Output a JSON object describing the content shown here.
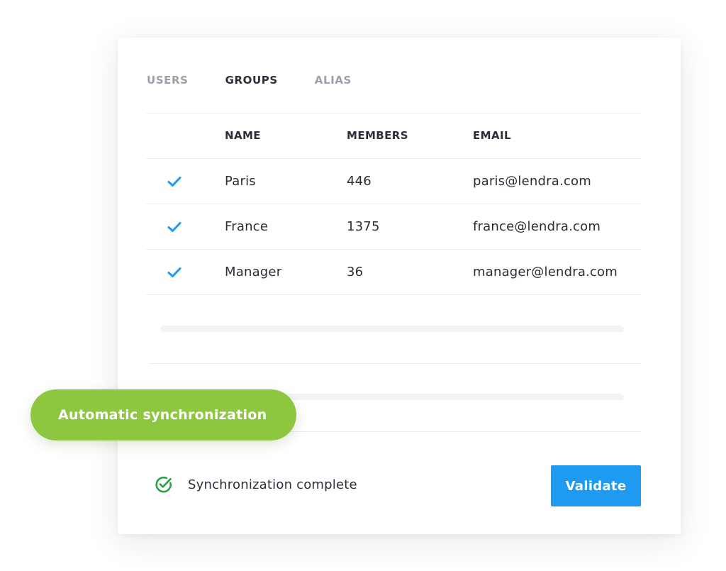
{
  "tabs": [
    {
      "label": "USERS",
      "active": false
    },
    {
      "label": "GROUPS",
      "active": true
    },
    {
      "label": "ALIAS",
      "active": false
    }
  ],
  "table": {
    "columns": [
      "NAME",
      "MEMBERS",
      "EMAIL"
    ],
    "rows": [
      {
        "checked": true,
        "name": "Paris",
        "members": "446",
        "email": "paris@lendra.com"
      },
      {
        "checked": true,
        "name": "France",
        "members": "1375",
        "email": "france@lendra.com"
      },
      {
        "checked": true,
        "name": "Manager",
        "members": "36",
        "email": "manager@lendra.com"
      }
    ]
  },
  "status": {
    "text": "Synchronization complete",
    "icon": "check-circle-icon"
  },
  "validate_label": "Validate",
  "badge_label": "Automatic synchronization",
  "colors": {
    "accent_blue": "#1e9bf0",
    "badge_green": "#8dc63f",
    "success_green": "#2aa14b"
  }
}
